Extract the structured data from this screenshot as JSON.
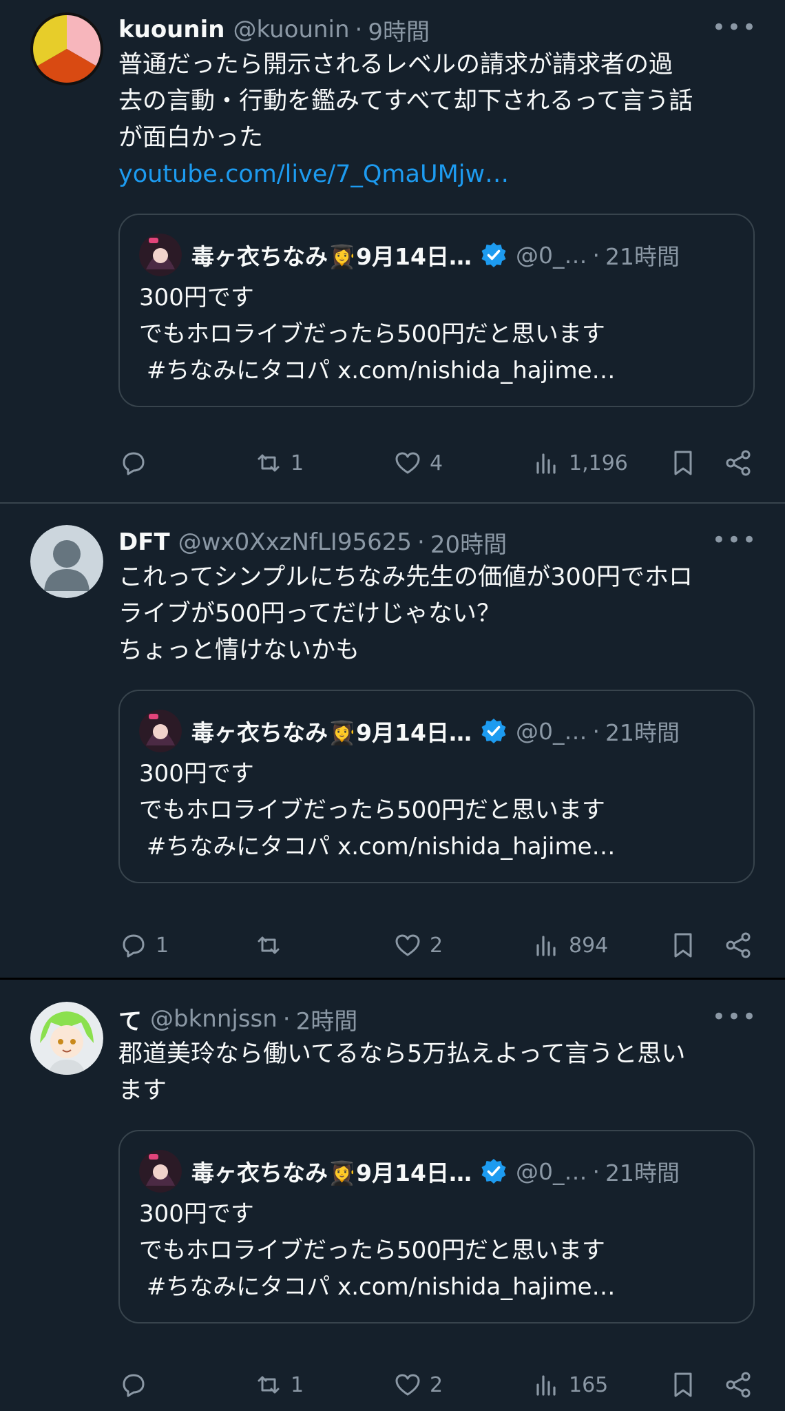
{
  "colors": {
    "background": "#15202b",
    "text": "#f7f9f9",
    "secondary": "#8b98a5",
    "link": "#1d9bf0",
    "border": "#38444d",
    "verified": "#1d9bf0"
  },
  "tweets": [
    {
      "name": "kuounin",
      "handle": "@kuounin",
      "dot": "·",
      "time": "9時間",
      "more": "•••",
      "text": "普通だったら開示されるレベルの請求が請求者の過\n去の言動・行動を鑑みてすべて却下されるって言う話\nが面白かった",
      "link": "youtube.com/live/7_QmaUMjw…",
      "quote": {
        "name": "毒ヶ衣ちなみ👩‍🎓9月14日…",
        "handle": "@0_…",
        "dot": "·",
        "time": "21時間",
        "text": "300円です\nでもホロライブだったら500円だと思います\n #ちなみにタコパ x.com/nishida_hajime…"
      },
      "actions": {
        "reply": "",
        "retweet": "1",
        "like": "4",
        "views": "1,196"
      }
    },
    {
      "name": "DFT",
      "handle": "@wx0XxzNfLI95625",
      "dot": "·",
      "time": "20時間",
      "more": "•••",
      "text": "これってシンプルにちなみ先生の価値が300円でホロ\nライブが500円ってだけじゃない？\nちょっと情けないかも",
      "quote": {
        "name": "毒ヶ衣ちなみ👩‍🎓9月14日…",
        "handle": "@0_…",
        "dot": "·",
        "time": "21時間",
        "text": "300円です\nでもホロライブだったら500円だと思います\n #ちなみにタコパ x.com/nishida_hajime…"
      },
      "actions": {
        "reply": "1",
        "retweet": "",
        "like": "2",
        "views": "894"
      }
    },
    {
      "name": "て",
      "handle": "@bknnjssn",
      "dot": "·",
      "time": "2時間",
      "more": "•••",
      "text": "郡道美玲なら働いてるなら5万払えよって言うと思い\nます",
      "quote": {
        "name": "毒ヶ衣ちなみ👩‍🎓9月14日…",
        "handle": "@0_…",
        "dot": "·",
        "time": "21時間",
        "text": "300円です\nでもホロライブだったら500円だと思います\n #ちなみにタコパ x.com/nishida_hajime…"
      },
      "actions": {
        "reply": "",
        "retweet": "1",
        "like": "2",
        "views": "165"
      }
    }
  ]
}
